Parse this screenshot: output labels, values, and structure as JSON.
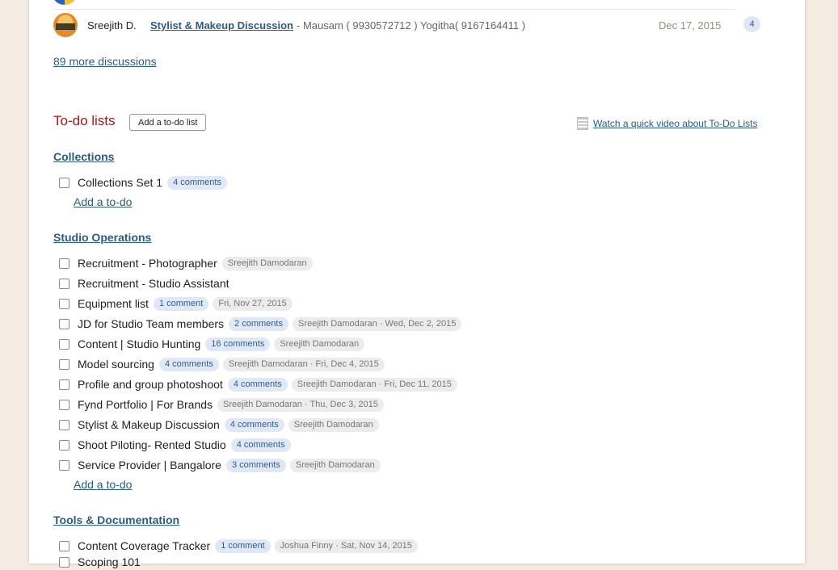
{
  "discussion": {
    "author": "Sreejith D.",
    "title": "Stylist & Makeup Discussion",
    "excerpt": "- Mausam ( 9930572712 ) Yogitha( 9167164411 )",
    "date": "Dec 17, 2015",
    "count": "4"
  },
  "more_discussions": "89 more discussions",
  "todos": {
    "heading": "To-do lists",
    "add_list_label": "Add a to-do list",
    "video_link": "Watch a quick video about To-Do Lists",
    "add_todo_label": "Add a to-do"
  },
  "lists": [
    {
      "name": "Collections",
      "items": [
        {
          "text": "Collections Set 1",
          "comments": "4 comments",
          "meta": ""
        }
      ]
    },
    {
      "name": "Studio Operations",
      "items": [
        {
          "text": "Recruitment - Photographer",
          "comments": "",
          "meta": "Sreejith Damodaran"
        },
        {
          "text": "Recruitment - Studio Assistant",
          "comments": "",
          "meta": ""
        },
        {
          "text": "Equipment list",
          "comments": "1 comment",
          "meta": "Fri, Nov 27, 2015"
        },
        {
          "text": "JD for Studio Team members",
          "comments": "2 comments",
          "meta": "Sreejith Damodaran · Wed, Dec 2, 2015"
        },
        {
          "text": "Content | Studio Hunting",
          "comments": "16 comments",
          "meta": "Sreejith Damodaran"
        },
        {
          "text": "Model sourcing",
          "comments": "4 comments",
          "meta": "Sreejith Damodaran · Fri, Dec 4, 2015"
        },
        {
          "text": "Profile and group photoshoot",
          "comments": "4 comments",
          "meta": "Sreejith Damodaran · Fri, Dec 11, 2015"
        },
        {
          "text": "Fynd Portfolio | For Brands",
          "comments": "",
          "meta": "Sreejith Damodaran · Thu, Dec 3, 2015"
        },
        {
          "text": "Stylist & Makeup Discussion",
          "comments": "4 comments",
          "meta": "Sreejith Damodaran"
        },
        {
          "text": "Shoot Piloting- Rented Studio",
          "comments": "4 comments",
          "meta": ""
        },
        {
          "text": "Service Provider | Bangalore",
          "comments": "3 comments",
          "meta": "Sreejith Damodaran"
        }
      ]
    },
    {
      "name": "Tools & Documentation",
      "items": [
        {
          "text": "Content Coverage Tracker",
          "comments": "1 comment",
          "meta": "Joshua Finny · Sat, Nov 14, 2015"
        },
        {
          "text": "Scoping 101",
          "comments": "",
          "meta": ""
        }
      ]
    }
  ],
  "colors": {
    "page_bg": "#f4ece2",
    "heading_red": "#a8161b",
    "link_blue": "#2e5b80",
    "comment_pill": "#dfe8f4",
    "meta_pill": "#ececec"
  }
}
